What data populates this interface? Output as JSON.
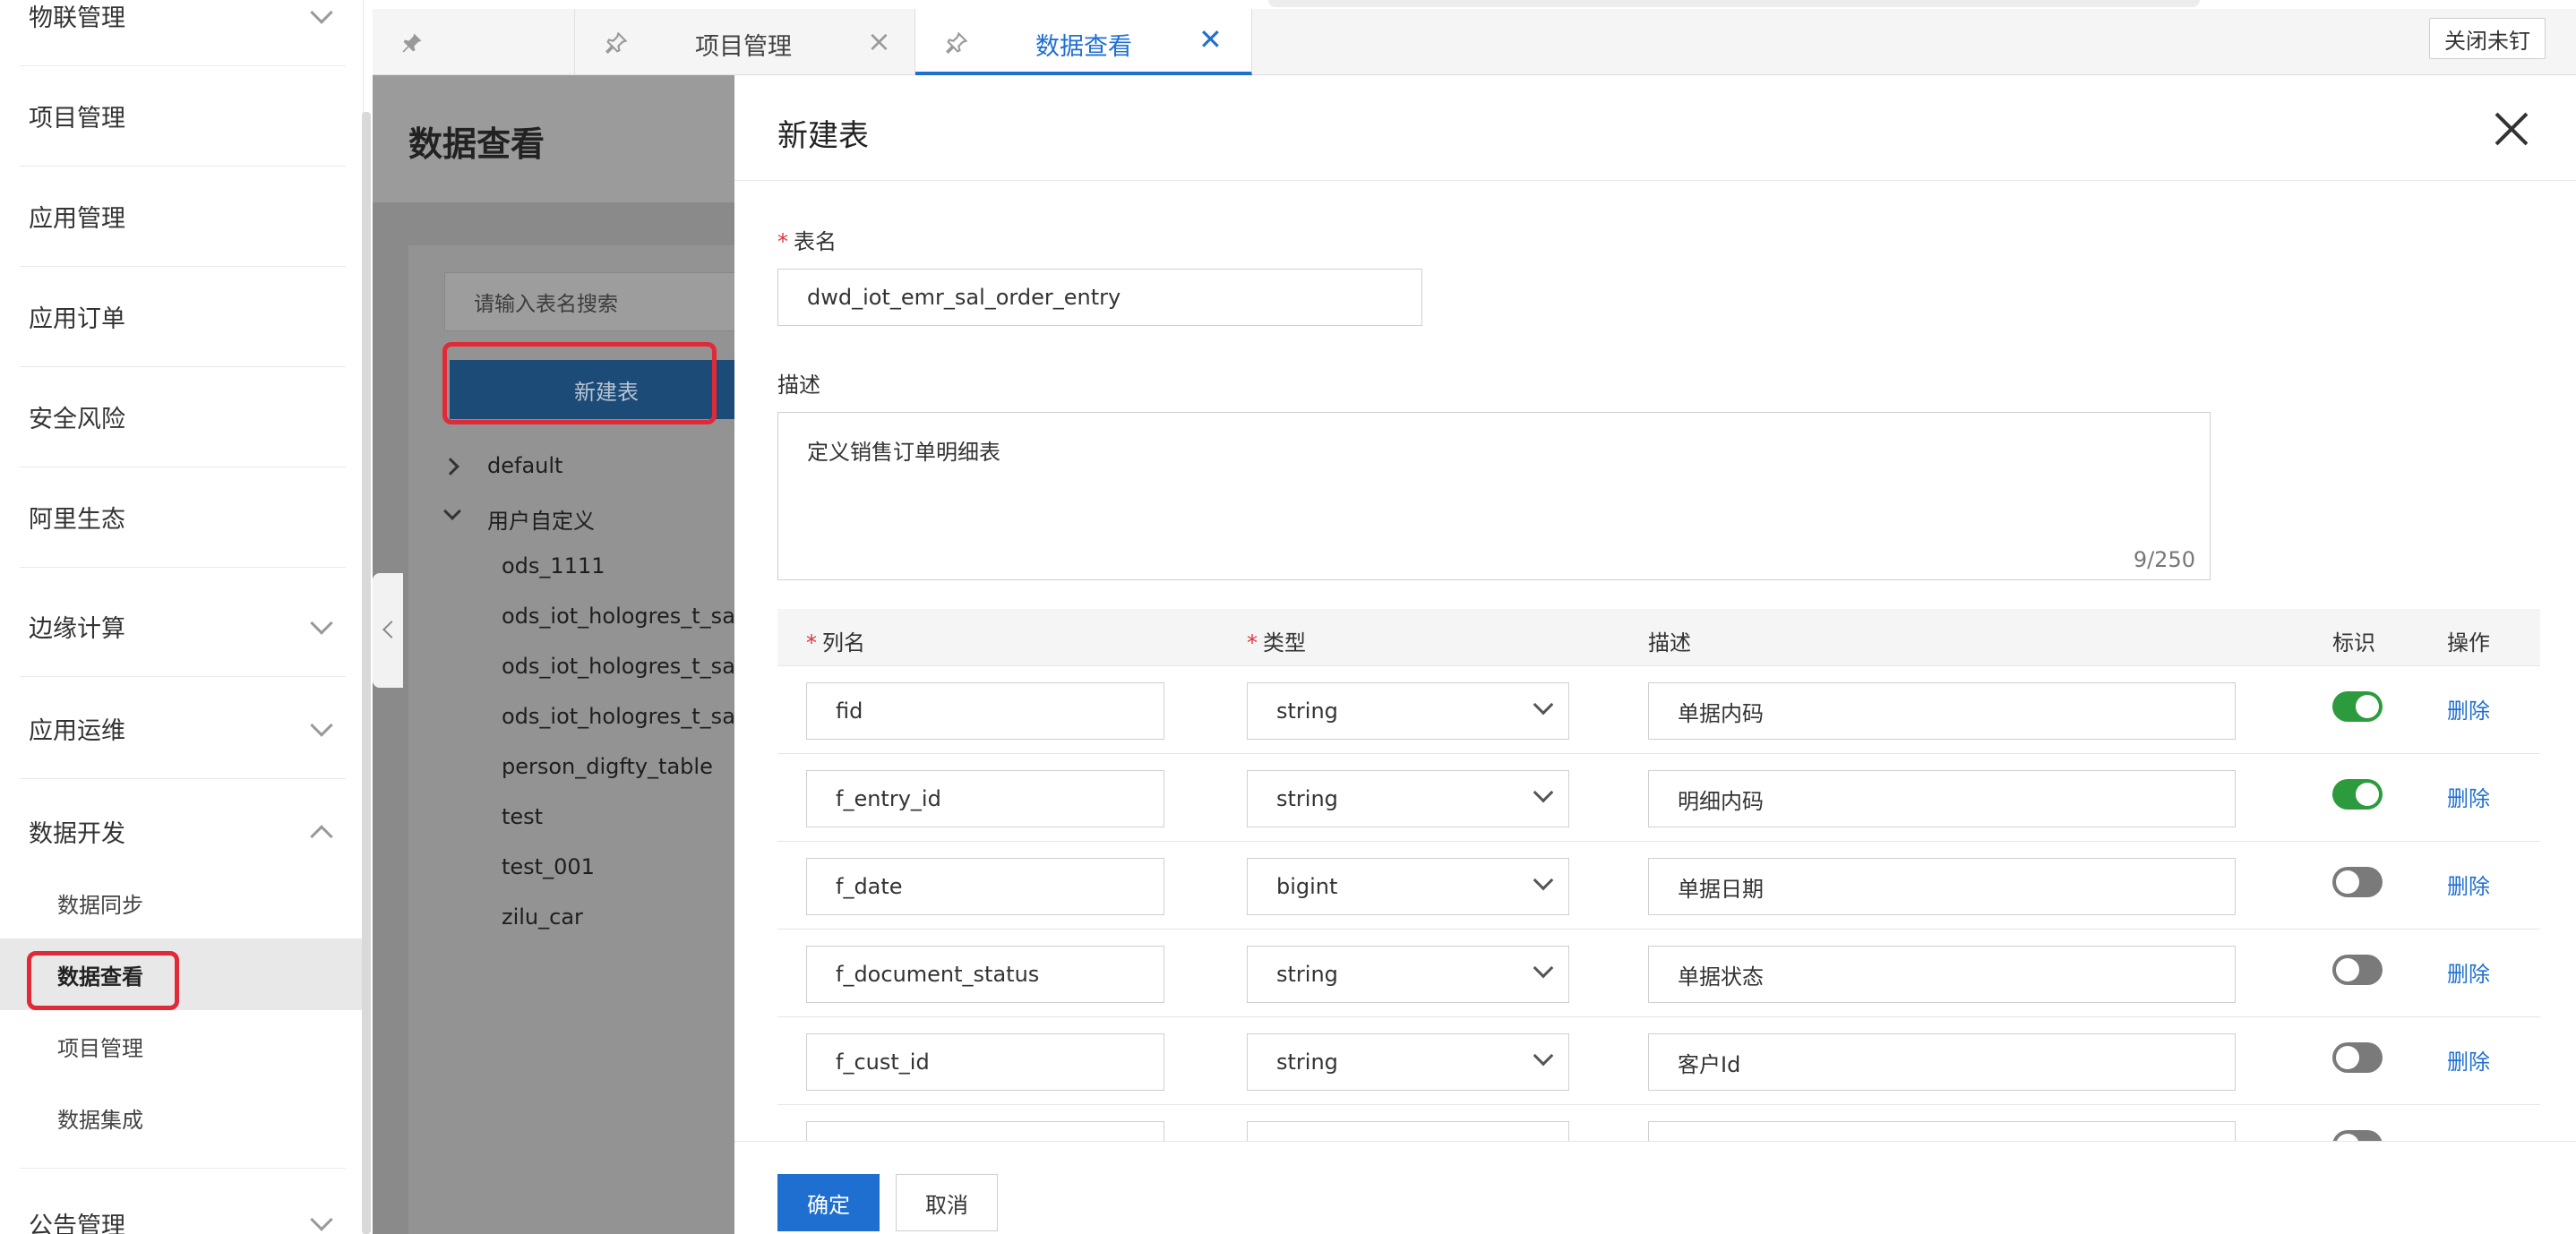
{
  "sidebar": {
    "items": [
      {
        "label": "物联管理",
        "chevron": "down"
      },
      {
        "label": "项目管理",
        "chevron": ""
      },
      {
        "label": "应用管理",
        "chevron": ""
      },
      {
        "label": "应用订单",
        "chevron": ""
      },
      {
        "label": "安全风险",
        "chevron": ""
      },
      {
        "label": "阿里生态",
        "chevron": ""
      },
      {
        "label": "边缘计算",
        "chevron": "down"
      },
      {
        "label": "应用运维",
        "chevron": "down"
      },
      {
        "label": "数据开发",
        "chevron": "up"
      }
    ],
    "sub_items": [
      {
        "label": "数据同步",
        "active": false
      },
      {
        "label": "数据查看",
        "active": true
      },
      {
        "label": "项目管理",
        "active": false
      },
      {
        "label": "数据集成",
        "active": false
      }
    ],
    "bottom_item": {
      "label": "公告管理",
      "chevron": "down"
    }
  },
  "tabs": {
    "items": [
      {
        "label": "",
        "closable": false,
        "active": false
      },
      {
        "label": "项目管理",
        "closable": true,
        "active": false
      },
      {
        "label": "数据查看",
        "closable": true,
        "active": true
      }
    ],
    "unpin_all_label": "关闭未钉"
  },
  "background_page": {
    "title": "数据查看",
    "search_placeholder": "请输入表名搜索",
    "new_table_button": "新建表",
    "tree": {
      "default_node": "default",
      "custom_node": "用户自定义",
      "tables": [
        "ods_1111",
        "ods_iot_hologres_t_sal_",
        "ods_iot_hologres_t_sal_",
        "ods_iot_hologres_t_sal_",
        "person_digfty_table",
        "test",
        "test_001",
        "zilu_car"
      ]
    }
  },
  "drawer": {
    "title": "新建表",
    "table_name_label": "表名",
    "table_name_value": "dwd_iot_emr_sal_order_entry",
    "description_label": "描述",
    "description_value": "定义销售订单明细表",
    "description_counter": "9/250",
    "columns_header": {
      "name": "列名",
      "type": "类型",
      "desc": "描述",
      "flag": "标识",
      "action": "操作"
    },
    "rows": [
      {
        "name": "fid",
        "type": "string",
        "desc": "单据内码",
        "flag": true,
        "action": "删除"
      },
      {
        "name": "f_entry_id",
        "type": "string",
        "desc": "明细内码",
        "flag": true,
        "action": "删除"
      },
      {
        "name": "f_date",
        "type": "bigint",
        "desc": "单据日期",
        "flag": false,
        "action": "删除"
      },
      {
        "name": "f_document_status",
        "type": "string",
        "desc": "单据状态",
        "flag": false,
        "action": "删除"
      },
      {
        "name": "f_cust_id",
        "type": "string",
        "desc": "客户Id",
        "flag": false,
        "action": "删除"
      }
    ],
    "confirm_label": "确定",
    "cancel_label": "取消"
  },
  "colors": {
    "accent": "#1f6fd1",
    "toggle_on": "#2c9b3e",
    "highlight_box": "#e02a37",
    "required_star": "#d9363e"
  }
}
